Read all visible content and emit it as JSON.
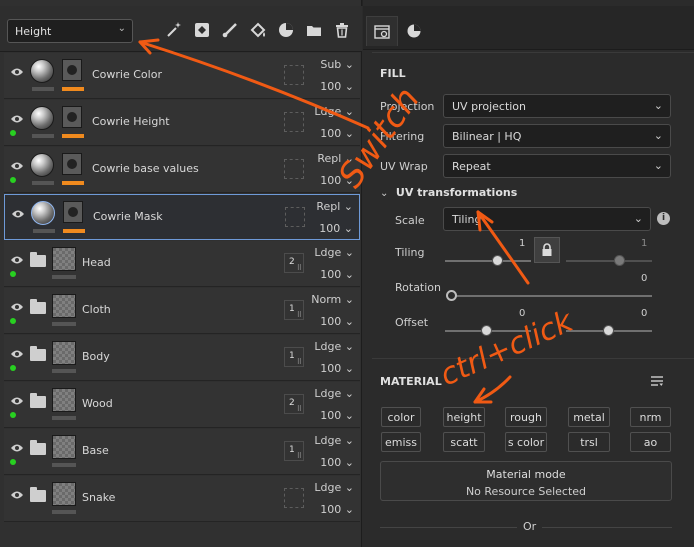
{
  "channel_select": {
    "value": "Height"
  },
  "toolbar": {
    "icons": [
      "magic-wand-icon",
      "add-fill-icon",
      "paint-brush-icon",
      "fill-bucket-icon",
      "smart-material-icon",
      "folder-icon",
      "trash-icon"
    ]
  },
  "layers": [
    {
      "name": "Cowrie Color",
      "blend": "Sub",
      "opacity": "100"
    },
    {
      "name": "Cowrie Height",
      "blend": "Ldge",
      "opacity": "100"
    },
    {
      "name": "Cowrie base values",
      "blend": "Repl",
      "opacity": "100"
    },
    {
      "name": "Cowrie Mask",
      "blend": "Repl",
      "opacity": "100"
    }
  ],
  "groups": [
    {
      "name": "Head",
      "count": "2",
      "blend": "Ldge",
      "opacity": "100"
    },
    {
      "name": "Cloth",
      "count": "1",
      "blend": "Norm",
      "opacity": "100"
    },
    {
      "name": "Body",
      "count": "1",
      "blend": "Ldge",
      "opacity": "100"
    },
    {
      "name": "Wood",
      "count": "2",
      "blend": "Ldge",
      "opacity": "100"
    },
    {
      "name": "Base",
      "count": "1",
      "blend": "Ldge",
      "opacity": "100"
    },
    {
      "name": "Snake",
      "count": "",
      "blend": "Ldge",
      "opacity": "100"
    }
  ],
  "fill": {
    "title": "FILL",
    "projection_label": "Projection",
    "projection_value": "UV projection",
    "filtering_label": "Filtering",
    "filtering_value": "Bilinear | HQ",
    "uvwrap_label": "UV Wrap",
    "uvwrap_value": "Repeat",
    "uvt_title": "UV transformations",
    "scale_label": "Scale",
    "scale_value": "Tiling",
    "tiling_label": "Tiling",
    "tiling_value_a": "1",
    "tiling_value_b": "1",
    "rotation_label": "Rotation",
    "rotation_value": "0",
    "offset_label": "Offset",
    "offset_value_a": "0",
    "offset_value_b": "0"
  },
  "material": {
    "title": "MATERIAL",
    "chips_row1": [
      "color",
      "height",
      "rough",
      "metal",
      "nrm"
    ],
    "chips_row2": [
      "emiss",
      "scatt",
      "s color",
      "trsl",
      "ao"
    ],
    "mode_label": "Material mode",
    "mode_value": "No Resource Selected",
    "or_label": "Or"
  },
  "annotations": {
    "switch_text": "Switch",
    "ctrl_click_text": "ctrl+click",
    "color": "#f05a14"
  },
  "colors": {
    "accent_orange": "#f08a1e",
    "green_dot": "#28d021",
    "selection_blue": "#6e9ad8"
  }
}
